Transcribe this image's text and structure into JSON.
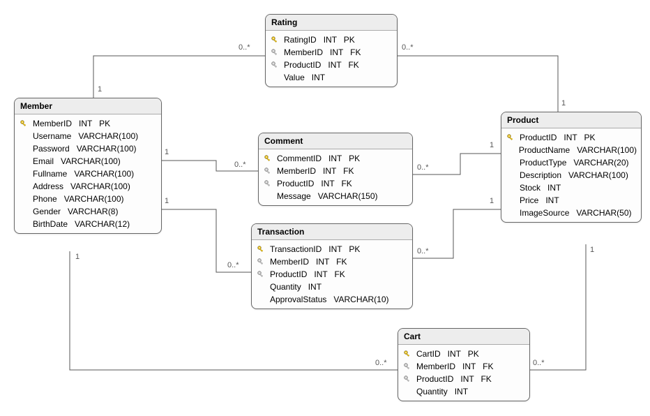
{
  "entities": {
    "member": {
      "title": "Member",
      "columns": [
        {
          "key": "pk",
          "name": "MemberID",
          "type": "INT",
          "suffix": "PK"
        },
        {
          "key": "",
          "name": "Username",
          "type": "VARCHAR(100)",
          "suffix": ""
        },
        {
          "key": "",
          "name": "Password",
          "type": "VARCHAR(100)",
          "suffix": ""
        },
        {
          "key": "",
          "name": "Email",
          "type": "VARCHAR(100)",
          "suffix": ""
        },
        {
          "key": "",
          "name": "Fullname",
          "type": "VARCHAR(100)",
          "suffix": ""
        },
        {
          "key": "",
          "name": "Address",
          "type": "VARCHAR(100)",
          "suffix": ""
        },
        {
          "key": "",
          "name": "Phone",
          "type": "VARCHAR(100)",
          "suffix": ""
        },
        {
          "key": "",
          "name": "Gender",
          "type": "VARCHAR(8)",
          "suffix": ""
        },
        {
          "key": "",
          "name": "BirthDate",
          "type": "VARCHAR(12)",
          "suffix": ""
        }
      ]
    },
    "rating": {
      "title": "Rating",
      "columns": [
        {
          "key": "pk",
          "name": "RatingID",
          "type": "INT",
          "suffix": "PK"
        },
        {
          "key": "fk",
          "name": "MemberID",
          "type": "INT",
          "suffix": "FK"
        },
        {
          "key": "fk",
          "name": "ProductID",
          "type": "INT",
          "suffix": "FK"
        },
        {
          "key": "",
          "name": "Value",
          "type": "INT",
          "suffix": ""
        }
      ]
    },
    "comment": {
      "title": "Comment",
      "columns": [
        {
          "key": "pk",
          "name": "CommentID",
          "type": "INT",
          "suffix": "PK"
        },
        {
          "key": "fk",
          "name": "MemberID",
          "type": "INT",
          "suffix": "FK"
        },
        {
          "key": "fk",
          "name": "ProductID",
          "type": "INT",
          "suffix": "FK"
        },
        {
          "key": "",
          "name": "Message",
          "type": "VARCHAR(150)",
          "suffix": ""
        }
      ]
    },
    "transaction": {
      "title": "Transaction",
      "columns": [
        {
          "key": "pk",
          "name": "TransactionID",
          "type": "INT",
          "suffix": "PK"
        },
        {
          "key": "fk",
          "name": "MemberID",
          "type": "INT",
          "suffix": "FK"
        },
        {
          "key": "fk",
          "name": "ProductID",
          "type": "INT",
          "suffix": "FK"
        },
        {
          "key": "",
          "name": "Quantity",
          "type": "INT",
          "suffix": ""
        },
        {
          "key": "",
          "name": "ApprovalStatus",
          "type": "VARCHAR(10)",
          "suffix": ""
        }
      ]
    },
    "cart": {
      "title": "Cart",
      "columns": [
        {
          "key": "pk",
          "name": "CartID",
          "type": "INT",
          "suffix": "PK"
        },
        {
          "key": "fk",
          "name": "MemberID",
          "type": "INT",
          "suffix": "FK"
        },
        {
          "key": "fk",
          "name": "ProductID",
          "type": "INT",
          "suffix": "FK"
        },
        {
          "key": "",
          "name": "Quantity",
          "type": "INT",
          "suffix": ""
        }
      ]
    },
    "product": {
      "title": "Product",
      "columns": [
        {
          "key": "pk",
          "name": "ProductID",
          "type": "INT",
          "suffix": "PK"
        },
        {
          "key": "",
          "name": "ProductName",
          "type": "VARCHAR(100)",
          "suffix": ""
        },
        {
          "key": "",
          "name": "ProductType",
          "type": "VARCHAR(20)",
          "suffix": ""
        },
        {
          "key": "",
          "name": "Description",
          "type": "VARCHAR(100)",
          "suffix": ""
        },
        {
          "key": "",
          "name": "Stock",
          "type": "INT",
          "suffix": ""
        },
        {
          "key": "",
          "name": "Price",
          "type": "INT",
          "suffix": ""
        },
        {
          "key": "",
          "name": "ImageSource",
          "type": "VARCHAR(50)",
          "suffix": ""
        }
      ]
    }
  },
  "multiplicities": {
    "memberRating1": "1",
    "memberRatingMany": "0..*",
    "memberComment1": "1",
    "memberCommentMany": "0..*",
    "memberTransaction1": "1",
    "memberTransactionMany": "0..*",
    "memberCart1": "1",
    "memberCartMany": "0..*",
    "productRating1": "1",
    "productRatingMany": "0..*",
    "productComment1": "1",
    "productCommentMany": "0..*",
    "productTransaction1": "1",
    "productTransactionMany": "0..*",
    "productCart1": "1",
    "productCartMany": "0..*"
  }
}
